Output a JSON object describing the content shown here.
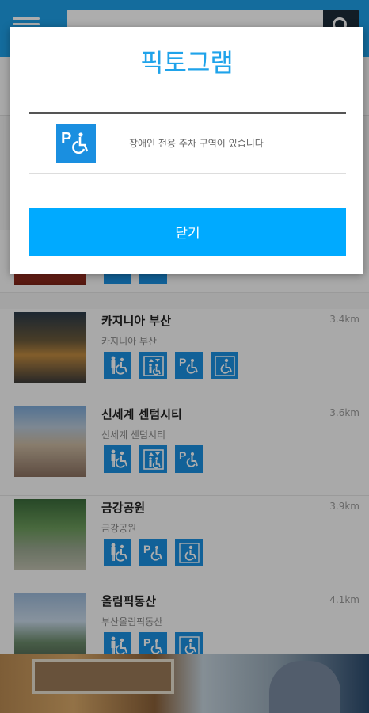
{
  "modal": {
    "title": "픽토그램",
    "items": [
      {
        "icon": "parking-accessible-icon",
        "description": "장애인 전용 주차 구역이 있습니다"
      }
    ],
    "close_label": "닫기"
  },
  "places": [
    {
      "name": "카지니아 부산",
      "subtitle": "카지니아 부산",
      "distance": "3.4km",
      "icons": [
        "restroom-accessible-icon",
        "elevator-accessible-icon",
        "parking-accessible-icon",
        "wheelchair-icon"
      ]
    },
    {
      "name": "신세계 센텀시티",
      "subtitle": "신세계 센텀시티",
      "distance": "3.6km",
      "icons": [
        "restroom-accessible-icon",
        "elevator-accessible-icon",
        "parking-accessible-icon"
      ]
    },
    {
      "name": "금강공원",
      "subtitle": "금강공원",
      "distance": "3.9km",
      "icons": [
        "restroom-accessible-icon",
        "parking-accessible-icon",
        "wheelchair-icon"
      ]
    },
    {
      "name": "올림픽동산",
      "subtitle": "부산올림픽동산",
      "distance": "4.1km",
      "icons": [
        "restroom-accessible-icon",
        "parking-accessible-icon",
        "wheelchair-icon"
      ]
    }
  ],
  "colors": {
    "accent": "#1fa3ea",
    "button": "#00aaff",
    "pictogram": "#1a8fe0",
    "header": "#1ea0e8"
  }
}
